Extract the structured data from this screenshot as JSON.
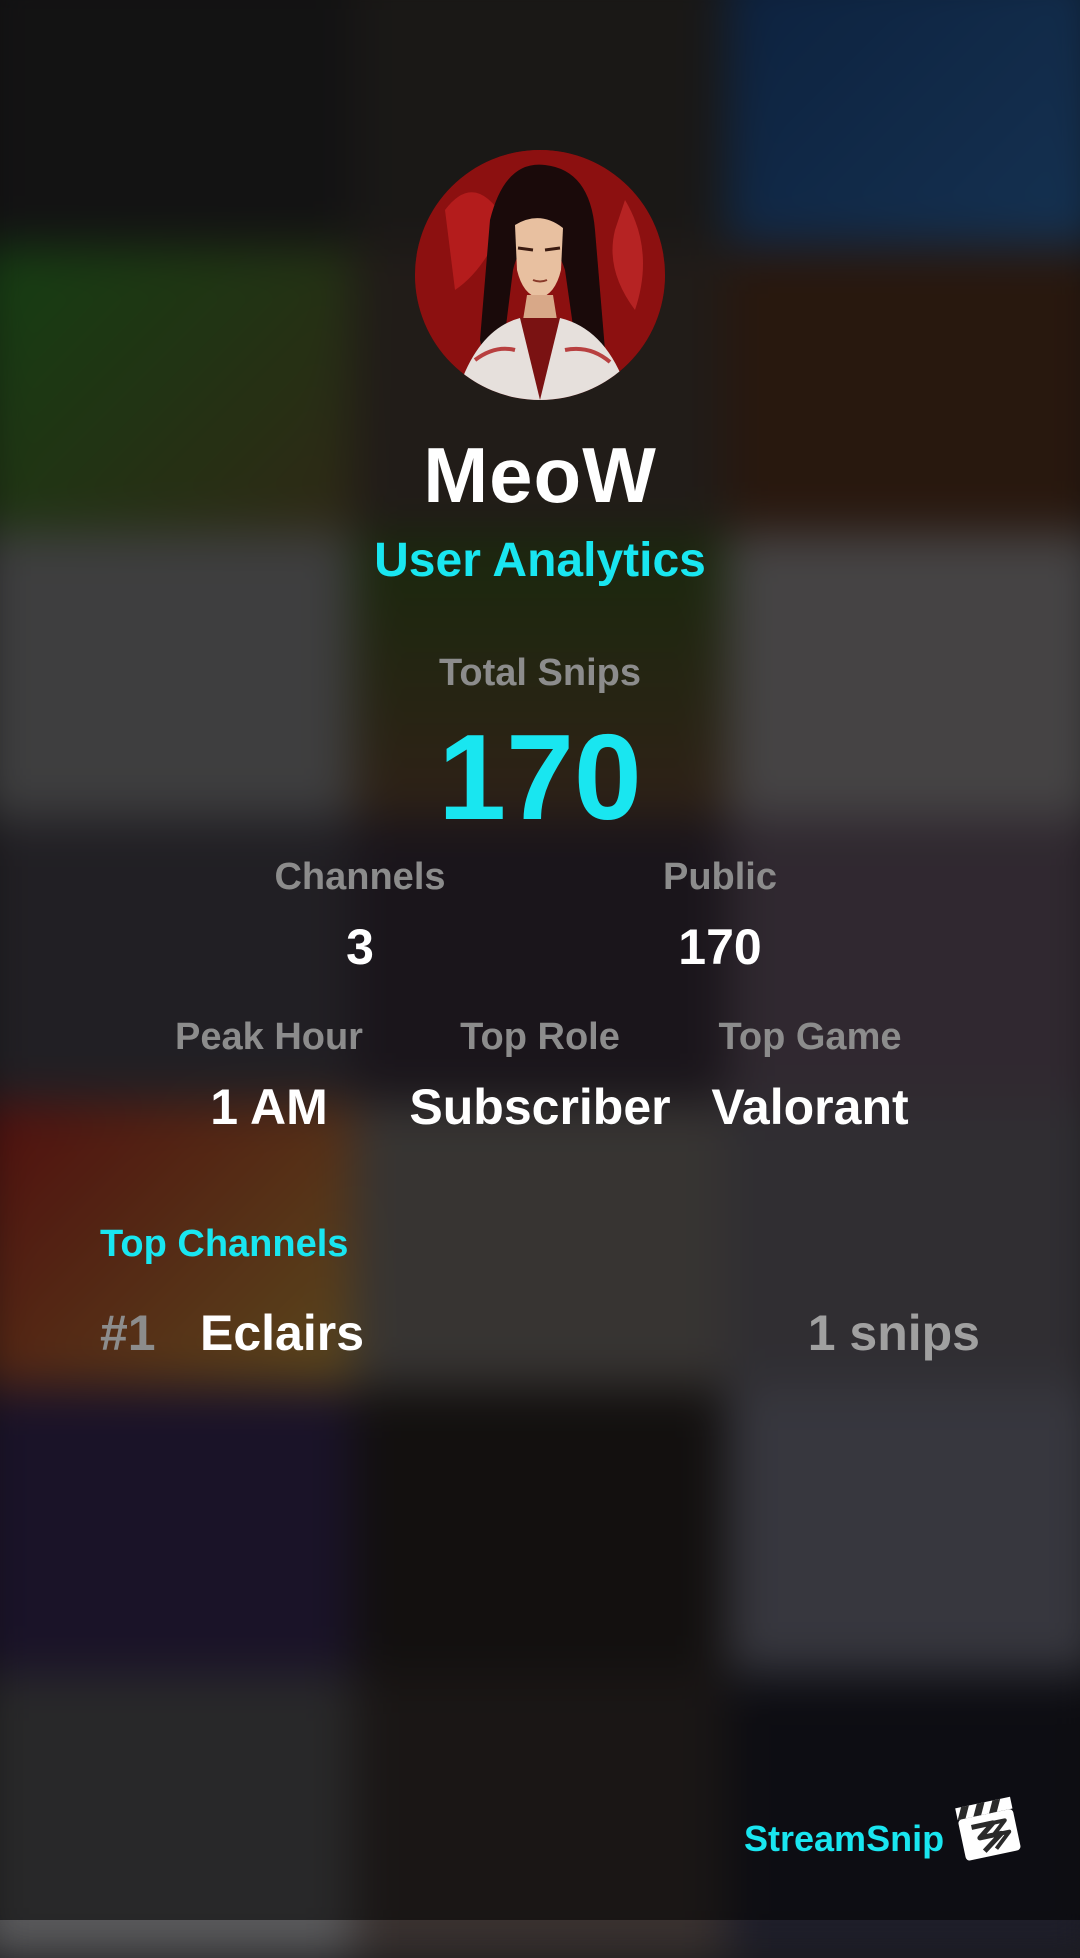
{
  "profile": {
    "username": "MeoW",
    "subtitle": "User Analytics"
  },
  "stats": {
    "total_label": "Total Snips",
    "total_value": "170",
    "channels_label": "Channels",
    "channels_value": "3",
    "public_label": "Public",
    "public_value": "170",
    "peak_hour_label": "Peak Hour",
    "peak_hour_value": "1 AM",
    "top_role_label": "Top Role",
    "top_role_value": "Subscriber",
    "top_game_label": "Top Game",
    "top_game_value": "Valorant"
  },
  "top_channels": {
    "title": "Top Channels",
    "items": [
      {
        "rank": "#1",
        "name": "Eclairs",
        "count": "1 snips"
      }
    ]
  },
  "brand": {
    "name": "StreamSnip",
    "logo_icon": "clapperboard-icon"
  },
  "colors": {
    "accent": "#19e6f0",
    "muted": "#8c8c8c",
    "text": "#ffffff"
  }
}
